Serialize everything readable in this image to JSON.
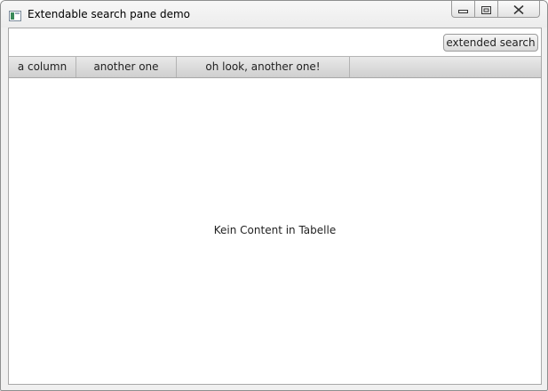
{
  "window": {
    "title": "Extendable search pane demo",
    "icon": "java-app-icon",
    "controls": {
      "minimize": "minimize-icon",
      "maximize": "maximize-icon",
      "close": "close-icon"
    }
  },
  "toolbar": {
    "extended_search_label": "extended search"
  },
  "table": {
    "columns": [
      "a column",
      "another one",
      "oh look, another one!"
    ],
    "rows": [],
    "placeholder": "Kein Content in Tabelle"
  }
}
